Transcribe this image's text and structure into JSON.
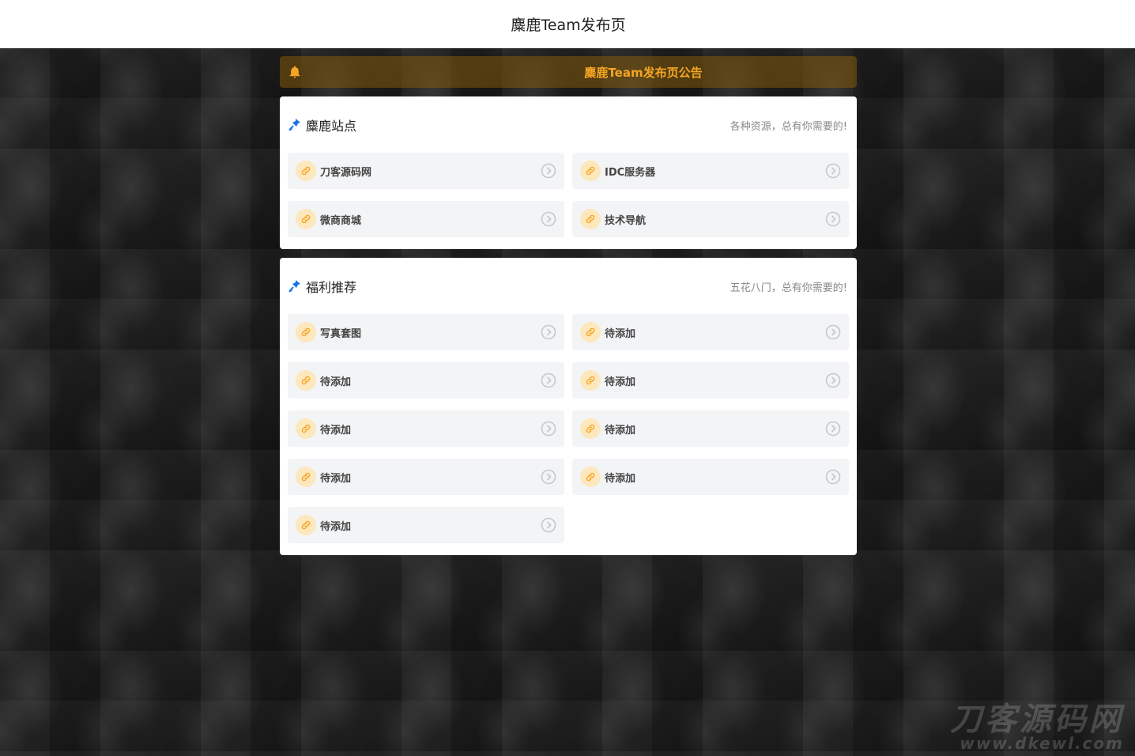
{
  "header": {
    "title": "麋鹿Team发布页"
  },
  "notice": {
    "text": "麋鹿Team发布页公告",
    "icon": "bell-icon",
    "color": "#f5a623"
  },
  "sections": [
    {
      "title": "麋鹿站点",
      "subtitle": "各种资源，总有你需要的!",
      "icon": "pin-icon",
      "items": [
        {
          "label": "刀客源码网"
        },
        {
          "label": "IDC服务器"
        },
        {
          "label": "微商商城"
        },
        {
          "label": "技术导航"
        }
      ]
    },
    {
      "title": "福利推荐",
      "subtitle": "五花八门，总有你需要的!",
      "icon": "pin-icon",
      "items": [
        {
          "label": "写真套图"
        },
        {
          "label": "待添加"
        },
        {
          "label": "待添加"
        },
        {
          "label": "待添加"
        },
        {
          "label": "待添加"
        },
        {
          "label": "待添加"
        },
        {
          "label": "待添加"
        },
        {
          "label": "待添加"
        },
        {
          "label": "待添加"
        }
      ]
    }
  ],
  "watermark": {
    "main": "刀客源码网",
    "sub": "www.dkewl.com"
  },
  "colors": {
    "accent": "#f5a623",
    "link_badge": "#fde7bd",
    "item_bg": "#f3f4f6"
  }
}
